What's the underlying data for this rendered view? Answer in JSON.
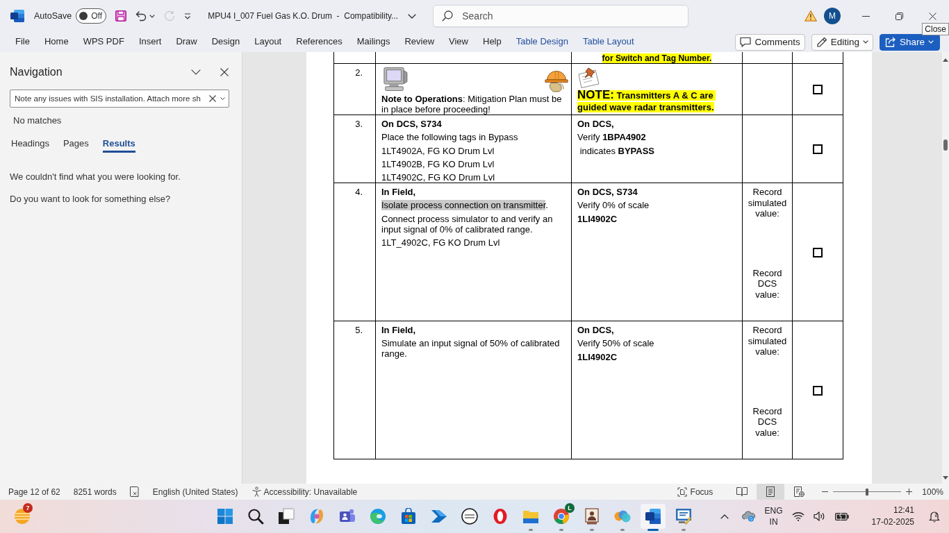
{
  "title_bar": {
    "autosave": {
      "label": "AutoSave",
      "on": false,
      "state": "Off"
    },
    "quick_access": [
      {
        "kind": "save",
        "disabled": false
      },
      {
        "kind": "undo",
        "disabled": false
      },
      {
        "kind": "redo",
        "disabled": true
      },
      {
        "kind": "customize",
        "disabled": false
      }
    ],
    "document_title": "MPU4 I_007 Fuel Gas K.O. Drum  -  Compatibility...",
    "search": {
      "placeholder": "Search"
    },
    "account_initial": "M",
    "tooltip": "Close"
  },
  "ribbon": {
    "tabs": [
      {
        "label": "File",
        "kind": "standard",
        "selected": false
      },
      {
        "label": "Home",
        "kind": "standard",
        "selected": false
      },
      {
        "label": "WPS PDF",
        "kind": "standard",
        "selected": false
      },
      {
        "label": "Insert",
        "kind": "standard",
        "selected": false
      },
      {
        "label": "Draw",
        "kind": "standard",
        "selected": false
      },
      {
        "label": "Design",
        "kind": "standard",
        "selected": false
      },
      {
        "label": "Layout",
        "kind": "standard",
        "selected": false
      },
      {
        "label": "References",
        "kind": "standard",
        "selected": false
      },
      {
        "label": "Mailings",
        "kind": "standard",
        "selected": false
      },
      {
        "label": "Review",
        "kind": "standard",
        "selected": false
      },
      {
        "label": "View",
        "kind": "standard",
        "selected": false
      },
      {
        "label": "Help",
        "kind": "standard",
        "selected": false
      },
      {
        "label": "Table Design",
        "kind": "contextual",
        "selected": false
      },
      {
        "label": "Table Layout",
        "kind": "contextual",
        "selected": false
      }
    ],
    "comments": "Comments",
    "editing": "Editing",
    "share": "Share"
  },
  "navigation": {
    "title": "Navigation",
    "search": {
      "value": "Note any issues with SIS installation. Attach more sh"
    },
    "status": "No matches",
    "tabs": [
      {
        "label": "Headings",
        "selected": false
      },
      {
        "label": "Pages",
        "selected": false
      },
      {
        "label": "Results",
        "selected": true
      }
    ],
    "messages": [
      "We couldn't find what you were looking for.",
      "Do you want to look for something else?"
    ]
  },
  "document": {
    "partial_row": {
      "text": "for Switch and Tag Number.",
      "highlighted": true
    },
    "rows": [
      {
        "number": "2.",
        "step": {
          "kind": "operations",
          "paragraphs": [
            {
              "kind": "text",
              "text": "**Note to Operations**: Mitigation Plan must be in place before proceeding!"
            }
          ]
        },
        "expected": {
          "kind": "pinned",
          "paragraphs": [
            {
              "kind": "note",
              "text": "**NOTE:** Transmitters A & C are guided wave radar transmitters.",
              "highlighted": true
            }
          ]
        },
        "checked": false
      },
      {
        "number": "3.",
        "step": {
          "kind": "plain",
          "paragraphs": [
            {
              "kind": "heading",
              "text": "On DCS, S734"
            },
            {
              "kind": "text",
              "text": "Place the following tags in Bypass"
            },
            {
              "kind": "text",
              "text": "1LT4902A, FG KO Drum Lvl"
            },
            {
              "kind": "text",
              "text": "1LT4902B, FG KO Drum Lvl"
            },
            {
              "kind": "text",
              "text": "1LT4902C, FG KO Drum Lvl"
            }
          ]
        },
        "expected": {
          "kind": "plain",
          "paragraphs": [
            {
              "kind": "heading",
              "text": "On DCS,"
            },
            {
              "kind": "text",
              "text": "Verify **1BPA4902**"
            },
            {
              "kind": "text",
              "text": " indicates **BYPASS**"
            }
          ]
        },
        "checked": false
      },
      {
        "number": "4.",
        "step": {
          "kind": "plain",
          "paragraphs": [
            {
              "kind": "heading",
              "text": "In Field,",
              "selected": false
            },
            {
              "kind": "text",
              "text": "Isolate process connection on transmitter",
              "selected": true,
              "suffix": "."
            },
            {
              "kind": "text",
              "text": "Connect process simulator to and verify an input signal of 0% of calibrated range.",
              "selected": false
            },
            {
              "kind": "text",
              "text": "1LT_4902C, FG KO Drum Lvl",
              "selected": false
            }
          ]
        },
        "expected": {
          "kind": "plain",
          "paragraphs": [
            {
              "kind": "heading",
              "text": "On DCS, S734"
            },
            {
              "kind": "text",
              "text": "Verify 0% of scale"
            },
            {
              "kind": "heading",
              "text": "1LI4902C"
            }
          ]
        },
        "record": [
          "Record simulated value:",
          "Record DCS value:"
        ],
        "checked": false
      },
      {
        "number": "5.",
        "step": {
          "kind": "plain",
          "paragraphs": [
            {
              "kind": "heading",
              "text": "In Field,"
            },
            {
              "kind": "text",
              "text": "Simulate an input signal of 50% of calibrated range."
            }
          ]
        },
        "expected": {
          "kind": "plain",
          "paragraphs": [
            {
              "kind": "heading",
              "text": "On DCS,"
            },
            {
              "kind": "text",
              "text": "Verify 50% of scale"
            },
            {
              "kind": "heading",
              "text": "1LI4902C"
            }
          ]
        },
        "record": [
          "Record simulated value:",
          "Record DCS value:"
        ],
        "checked": false
      }
    ]
  },
  "status_bar": {
    "page": "Page 12 of 62",
    "words": "8251 words",
    "language": "English (United States)",
    "accessibility": "Accessibility: Unavailable",
    "focus": "Focus",
    "views": [
      {
        "kind": "read",
        "selected": false
      },
      {
        "kind": "print",
        "selected": true
      },
      {
        "kind": "web",
        "selected": false
      }
    ],
    "zoom": {
      "level": 0.5,
      "reading": "100%"
    }
  },
  "taskbar": {
    "widget_badge": "7",
    "apps": [
      {
        "kind": "start",
        "running": false,
        "active": false
      },
      {
        "kind": "search",
        "running": false,
        "active": false
      },
      {
        "kind": "taskview",
        "running": false,
        "active": false
      },
      {
        "kind": "swirl",
        "running": false,
        "active": false
      },
      {
        "kind": "people",
        "running": false,
        "active": false
      },
      {
        "kind": "wave",
        "running": false,
        "active": false
      },
      {
        "kind": "bag",
        "running": false,
        "active": false
      },
      {
        "kind": "arrow",
        "running": false,
        "active": false
      },
      {
        "kind": "ring",
        "running": false,
        "active": false
      },
      {
        "kind": "oring",
        "running": false,
        "active": false
      },
      {
        "kind": "folder",
        "running": true,
        "active": false
      },
      {
        "kind": "browser",
        "running": true,
        "active": false,
        "badge": "L"
      },
      {
        "kind": "portrait",
        "running": true,
        "active": false
      },
      {
        "kind": "blobs",
        "running": true,
        "active": false
      },
      {
        "kind": "document",
        "running": true,
        "active": true
      },
      {
        "kind": "screen",
        "running": true,
        "active": false
      }
    ],
    "tray": {
      "language": "ENG",
      "region": "IN",
      "time": "12:41",
      "date": "17-02-2025"
    }
  }
}
